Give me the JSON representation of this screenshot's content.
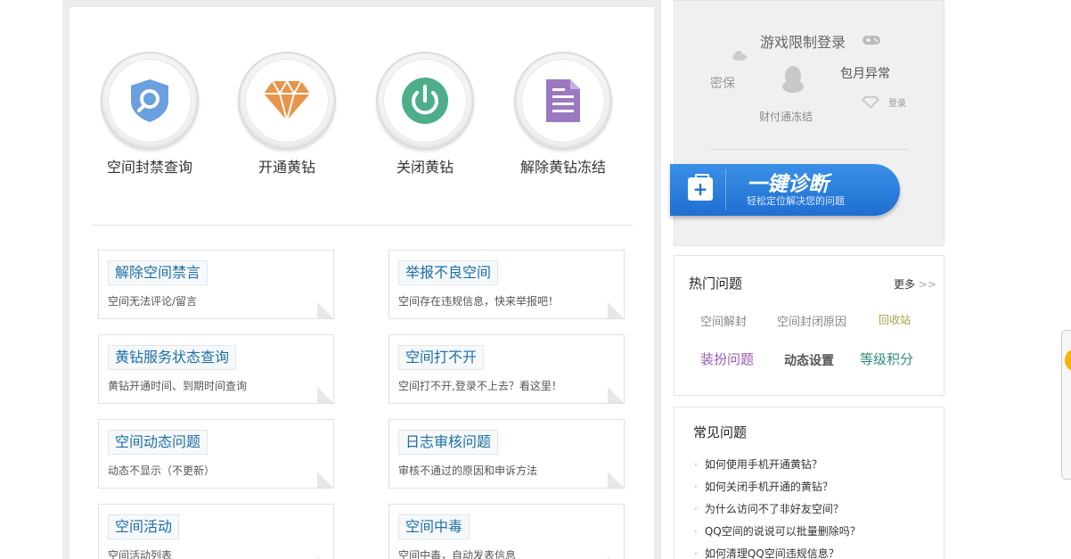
{
  "tools": [
    {
      "label": "空间封禁查询",
      "icon": "shield-search-icon",
      "color": "#6a9fe0"
    },
    {
      "label": "开通黄钻",
      "icon": "diamond-icon",
      "color": "#e8944a"
    },
    {
      "label": "关闭黄钻",
      "icon": "power-icon",
      "color": "#4fae8a"
    },
    {
      "label": "解除黄钻冻结",
      "icon": "document-icon",
      "color": "#9b79c0"
    }
  ],
  "cards": [
    {
      "title": "解除空间禁言",
      "desc": "空间无法评论/留言"
    },
    {
      "title": "举报不良空间",
      "desc": "空间存在违规信息，快来举报吧！"
    },
    {
      "title": "黄钻服务状态查询",
      "desc": "黄钻开通时间、到期时间查询"
    },
    {
      "title": "空间打不开",
      "desc": "空间打不开,登录不上去？看这里！"
    },
    {
      "title": "空间动态问题",
      "desc": "动态不显示（不更新）"
    },
    {
      "title": "日志审核问题",
      "desc": "审核不通过的原因和申诉方法"
    },
    {
      "title": "空间活动",
      "desc": "空间活动列表"
    },
    {
      "title": "空间中毒",
      "desc": "空间中毒，自动发表信息"
    }
  ],
  "diagnose": {
    "cloud": {
      "game_login": "游戏限制登录",
      "mibao": "密保",
      "monthly": "包月异常",
      "login": "登录",
      "caifutong": "财付通冻结"
    },
    "button_title": "一键诊断",
    "button_sub": "轻松定位解决您的问题"
  },
  "hot": {
    "title": "热门问题",
    "more": "更多",
    "links": [
      {
        "text": "空间解封",
        "color": "#888888"
      },
      {
        "text": "空间封闭原因",
        "color": "#888888"
      },
      {
        "text": "回收站",
        "color": "#a0a04a"
      },
      {
        "text": "装扮问题",
        "color": "#9b59b6"
      },
      {
        "text": "动态设置",
        "color": "#555555"
      },
      {
        "text": "等级积分",
        "color": "#2e8b7a"
      }
    ]
  },
  "faq": {
    "title": "常见问题",
    "items": [
      "如何使用手机开通黄钻？",
      "如何关闭手机开通的黄钻？",
      "为什么访问不了非好友空间？",
      "QQ空间的说说可以批量删除吗？",
      "如何清理QQ空间违规信息？"
    ]
  }
}
